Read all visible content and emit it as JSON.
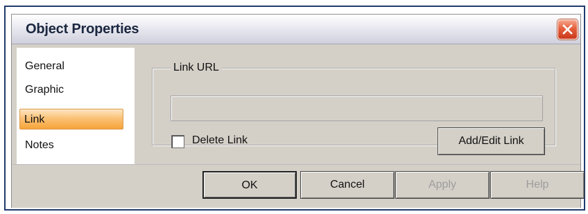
{
  "window": {
    "title": "Object Properties",
    "close_icon": "close-icon"
  },
  "tabs": [
    {
      "label": "General",
      "selected": false
    },
    {
      "label": "Graphic",
      "selected": false
    },
    {
      "label": "Link",
      "selected": true
    },
    {
      "label": "Notes",
      "selected": false
    }
  ],
  "link_panel": {
    "group_label": "Link URL",
    "url_value": "",
    "delete_link_label": "Delete Link",
    "delete_link_checked": false,
    "add_edit_label": "Add/Edit Link"
  },
  "footer": {
    "ok_label": "OK",
    "cancel_label": "Cancel",
    "apply_label": "Apply",
    "help_label": "Help"
  },
  "colors": {
    "selected_tab": "#f6a43a",
    "close_button": "#d64a28",
    "disabled_text": "#9c9c9c"
  }
}
